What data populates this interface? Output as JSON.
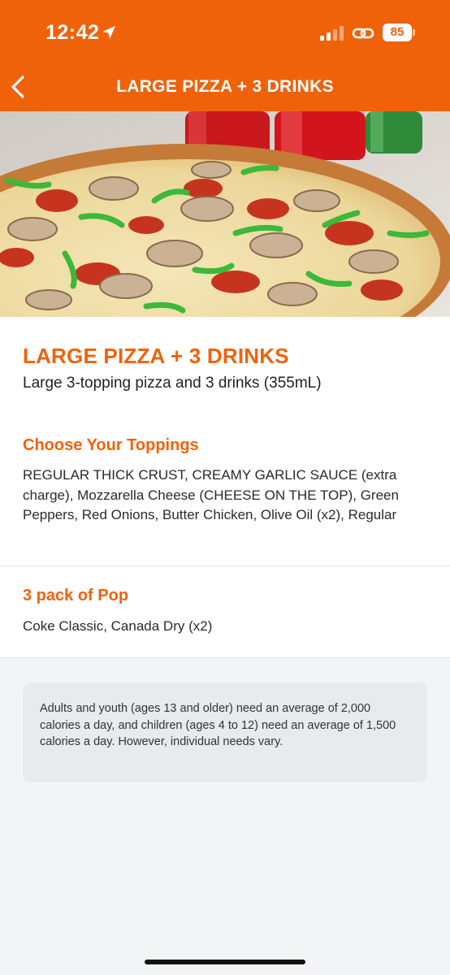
{
  "status_bar": {
    "time": "12:42",
    "battery": "85",
    "icons": [
      "location-arrow-icon",
      "signal-bars-icon",
      "link-icon",
      "battery-icon"
    ]
  },
  "nav": {
    "title": "LARGE PIZZA + 3 DRINKS",
    "back_icon": "chevron-left-icon"
  },
  "colors": {
    "brand": "#f0620a",
    "background": "#f2f4f6",
    "card": "#ffffff",
    "note_bg": "#e9eaee"
  },
  "item": {
    "title": "LARGE PIZZA + 3 DRINKS",
    "description": "Large 3-topping pizza and 3 drinks (355mL)"
  },
  "sections": [
    {
      "title": "Choose Your Toppings",
      "body": "REGULAR THICK CRUST, CREAMY GARLIC SAUCE (extra charge), Mozzarella Cheese (CHEESE ON THE TOP), Green Peppers, Red Onions, Butter Chicken, Olive Oil (x2), Regular"
    },
    {
      "title": "3 pack of Pop",
      "body": "Coke Classic, Canada Dry (x2)"
    }
  ],
  "note": "Adults and youth (ages 13 and older) need an average of 2,000 calories a day, and children (ages 4 to 12) need an average of 1,500 calories a day. However, individual needs vary."
}
